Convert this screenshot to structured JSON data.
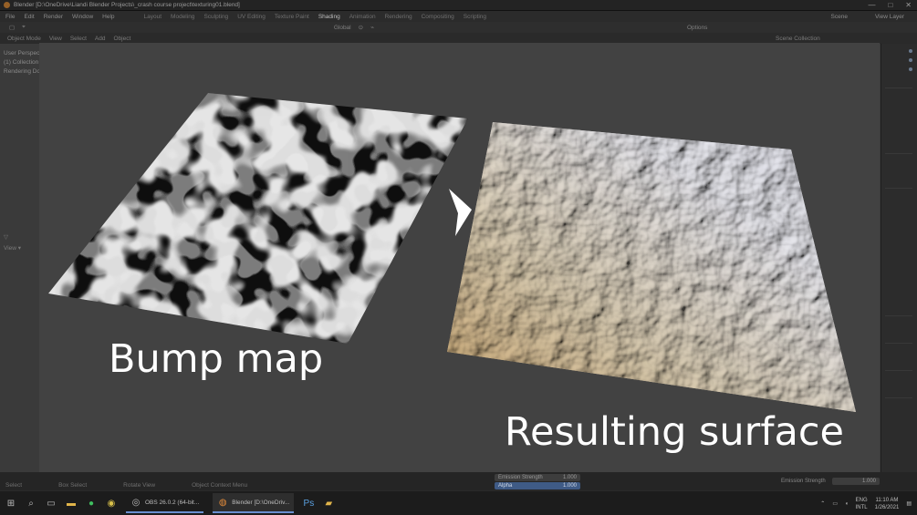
{
  "window": {
    "title": "Blender [D:\\OneDrive\\Liandi Blender Projects\\_crash course project\\texturing01.blend]",
    "controls": [
      "—",
      "□",
      "✕"
    ]
  },
  "menubar": {
    "menus": [
      "File",
      "Edit",
      "Render",
      "Window",
      "Help"
    ],
    "workspaces": [
      "Layout",
      "Modeling",
      "Sculpting",
      "UV Editing",
      "Texture Paint",
      "Shading",
      "Animation",
      "Rendering",
      "Compositing",
      "Scripting"
    ],
    "active_workspace": "Shading",
    "scene_label": "Scene",
    "view_layer_label": "View Layer"
  },
  "toolbar": {
    "transform": "Global",
    "options": "Options"
  },
  "viewport_header": {
    "mode": "Object Mode",
    "menus": [
      "View",
      "Select",
      "Add",
      "Object"
    ],
    "outliner_title": "Scene Collection"
  },
  "viewport_overlay": {
    "lines": [
      "User Perspective",
      "(1) Collection | Plane",
      "Rendering Done"
    ]
  },
  "left_controls": {
    "slot": "▽",
    "view": "View ▾"
  },
  "node_editor": {
    "emission_strength_label": "Emission Strength",
    "emission_strength_value": "1.000",
    "alpha_label": "Alpha",
    "alpha_value": "1.000",
    "right_label": "Emission Strength",
    "right_value": "1.000"
  },
  "statusbar": {
    "items": [
      "Select",
      "Box Select",
      "Rotate View",
      "Object Context Menu"
    ]
  },
  "taskbar": {
    "apps": [
      {
        "label": "OBS 26.0.2 (64-bit...",
        "active": false
      },
      {
        "label": "Blender [D:\\OneDriv...",
        "active": true
      }
    ],
    "language": "ENG",
    "language_sub": "INTL",
    "time": "11:10 AM",
    "date": "1/26/2021"
  },
  "slide": {
    "left_caption": "Bump map",
    "right_caption": "Resulting surface",
    "arrow_icon": "right-arrow-icon"
  },
  "colors": {
    "slide_background": "#424242",
    "caption": "#ffffff",
    "surface_light": "#e4e4ea",
    "surface_warm": "#c9a46b"
  }
}
